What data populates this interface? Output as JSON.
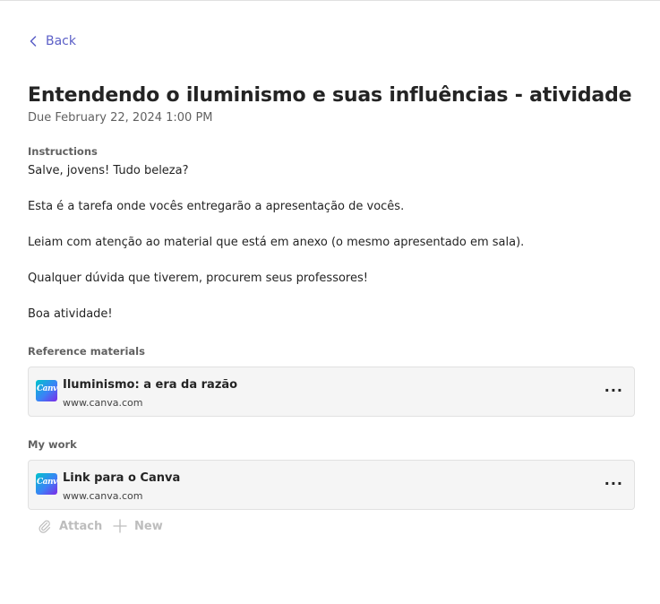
{
  "nav": {
    "back_label": "Back"
  },
  "assignment": {
    "title": "Entendendo o iluminismo e suas influências - atividade",
    "due": "Due February 22, 2024 1:00 PM"
  },
  "instructions": {
    "label": "Instructions",
    "lines": [
      "Salve, jovens! Tudo beleza?",
      "Esta é a tarefa onde vocês entregarão a apresentação de vocês.",
      "Leiam com atenção ao material que está em anexo (o mesmo apresentado em sala).",
      "Qualquer dúvida que tiverem, procurem seus professores!",
      "Boa atividade!"
    ]
  },
  "reference_materials": {
    "label": "Reference materials",
    "items": [
      {
        "name": "Iluminismo: a era da razão",
        "url": "www.canva.com",
        "icon": "canva-icon",
        "thumb_text": "Canva"
      }
    ]
  },
  "my_work": {
    "label": "My work",
    "items": [
      {
        "name": "Link para o Canva",
        "url": "www.canva.com",
        "icon": "canva-icon",
        "thumb_text": "Canva"
      }
    ]
  },
  "actions": {
    "attach_label": "Attach",
    "new_label": "New"
  },
  "colors": {
    "accent": "#5b5fc7",
    "card_bg": "#f5f5f5",
    "disabled": "#bdbdbd"
  }
}
